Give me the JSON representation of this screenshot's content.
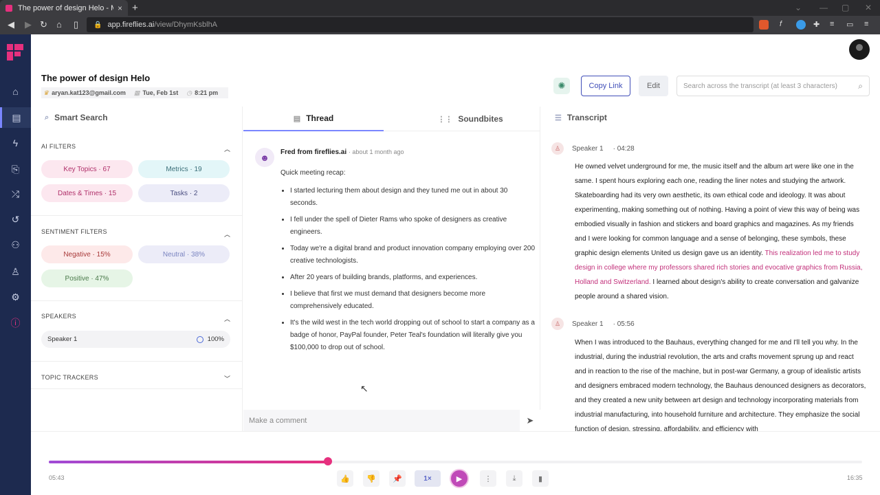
{
  "browser": {
    "tab_title": "The power of design Helo - Meet",
    "url_domain": "app.fireflies.ai",
    "url_path": "/view/DhymKsblhA"
  },
  "meeting": {
    "title": "The power of design Helo",
    "email": "aryan.kat123@gmail.com",
    "date": "Tue, Feb 1st",
    "time": "8:21 pm"
  },
  "header": {
    "copy_link": "Copy Link",
    "edit": "Edit",
    "search_placeholder": "Search across the transcript (at least 3 characters)"
  },
  "left": {
    "heading": "Smart Search",
    "ai_filters": "AI FILTERS",
    "chips_ai": [
      "Key Topics · 67",
      "Metrics · 19",
      "Dates & Times · 15",
      "Tasks · 2"
    ],
    "sentiment_filters": "SENTIMENT FILTERS",
    "chips_sentiment": [
      "Negative · 15%",
      "Neutral · 38%",
      "Positive · 47%"
    ],
    "speakers": "SPEAKERS",
    "speaker_name": "Speaker 1",
    "speaker_pct": "100%",
    "topic_trackers": "TOPIC TRACKERS"
  },
  "middle": {
    "tab_thread": "Thread",
    "tab_soundbites": "Soundbites",
    "sender": "Fred from fireflies.ai",
    "sent_time": "about 1 month ago",
    "recap": "Quick meeting recap:",
    "bullets": [
      "I started lecturing them about design and they tuned me out in about 30 seconds.",
      "I fell under the spell of Dieter Rams who spoke of designers as creative engineers.",
      "Today we're a digital brand and product innovation company employing over 200 creative technologists.",
      "After 20 years of building brands, platforms, and experiences.",
      "I believe that first we must demand that designers become more comprehensively educated.",
      "It's the wild west in the tech world dropping out of school to start a company as a badge of honor, PayPal founder, Peter Teal's foundation will literally give you $100,000 to drop out of school."
    ],
    "comment_placeholder": "Make a comment"
  },
  "right": {
    "heading": "Transcript",
    "entries": [
      {
        "speaker": "Speaker 1",
        "time": "04:28",
        "text_a": "He owned velvet underground for me, the music itself and the album art were like one in the same. I spent hours exploring each one, reading the liner notes and studying the artwork. Skateboarding had its very own aesthetic, its own ethical code and ideology. It was about experimenting, making something out of nothing. Having a point of view this way of being was embodied visually in fashion and stickers and board graphics and magazines. As my friends and I were looking for common language and a sense of belonging, these symbols, these graphic design elements United us design gave us an identity. ",
        "text_hl": "This realization led me to study design in college where my professors shared rich stories and evocative graphics from Russia, Holland and Switzerland.",
        "text_b": " I learned about design's ability to create conversation and galvanize people around a shared vision."
      },
      {
        "speaker": "Speaker 1",
        "time": "05:56",
        "text_a": "When I was introduced to the Bauhaus, everything changed for me and I'll tell you why. In the industrial, during the industrial revolution, the arts and crafts movement sprung up and react and in reaction to the rise of the machine, but in post-war Germany, a group of idealistic artists and designers embraced modern technology, the Bauhaus denounced designers as decorators, and they created a new unity between art design and technology incorporating materials from industrial manufacturing, into household furniture and architecture. They emphasize the social function of design, stressing, affordability, and efficiency with"
      }
    ]
  },
  "player": {
    "current": "05:43",
    "total": "16:35",
    "speed": "1×",
    "progress_fraction": 0.343
  },
  "colors": {
    "accent": "#e6307e",
    "nav_bg": "#1d2a4f",
    "primary_button": "#3f4db8"
  }
}
